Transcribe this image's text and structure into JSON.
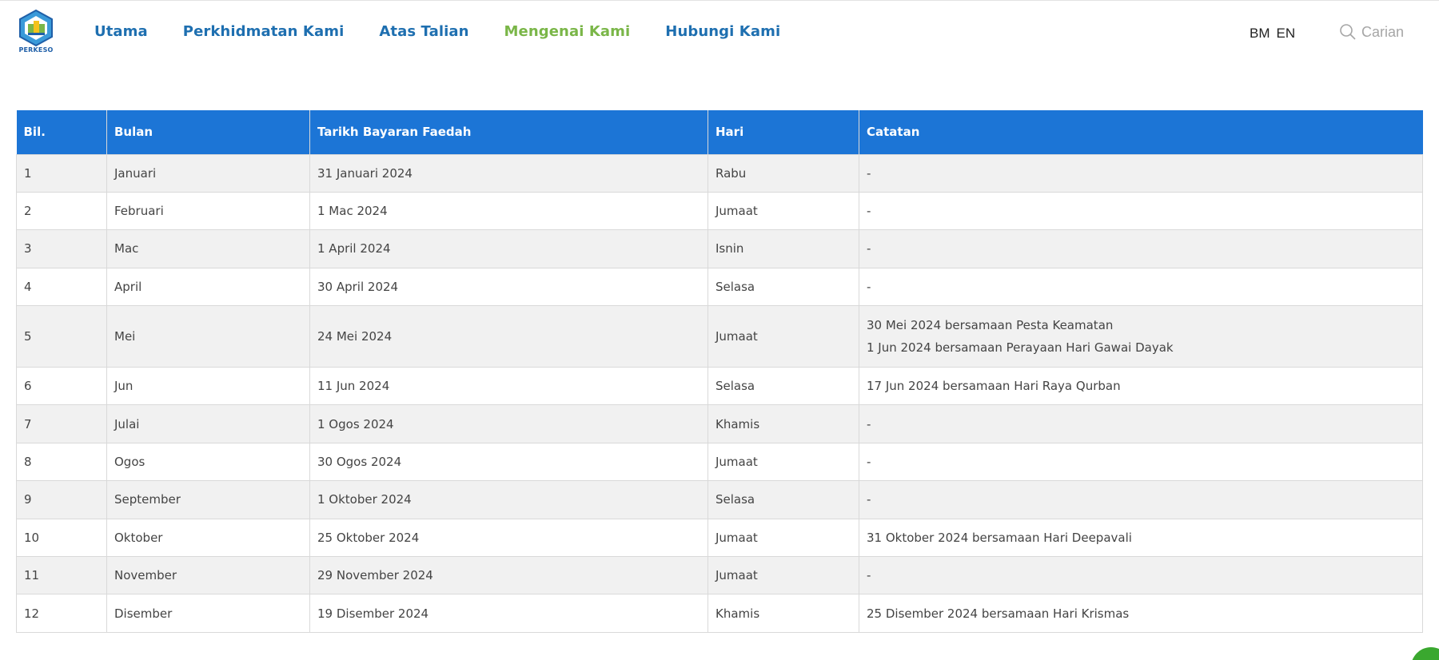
{
  "logo": {
    "text": "PERKESO"
  },
  "nav": [
    {
      "label": "Utama",
      "active": false
    },
    {
      "label": "Perkhidmatan Kami",
      "active": false
    },
    {
      "label": "Atas Talian",
      "active": false
    },
    {
      "label": "Mengenai Kami",
      "active": true
    },
    {
      "label": "Hubungi Kami",
      "active": false
    }
  ],
  "lang": {
    "bm": "BM",
    "en": "EN"
  },
  "search": {
    "placeholder": "Carian",
    "icon": "search-icon"
  },
  "colors": {
    "header_bg": "#1c75d6",
    "nav_link": "#1e6fb0",
    "nav_active": "#7ab648"
  },
  "table": {
    "headers": [
      "Bil.",
      "Bulan",
      "Tarikh Bayaran Faedah",
      "Hari",
      "Catatan"
    ],
    "rows": [
      {
        "bil": "1",
        "bulan": "Januari",
        "tarikh": "31 Januari 2024",
        "hari": "Rabu",
        "catatan": [
          "-"
        ]
      },
      {
        "bil": "2",
        "bulan": "Februari",
        "tarikh": "1 Mac 2024",
        "hari": "Jumaat",
        "catatan": [
          "-"
        ]
      },
      {
        "bil": "3",
        "bulan": "Mac",
        "tarikh": "1 April 2024",
        "hari": "Isnin",
        "catatan": [
          "-"
        ]
      },
      {
        "bil": "4",
        "bulan": "April",
        "tarikh": "30 April 2024",
        "hari": "Selasa",
        "catatan": [
          "-"
        ]
      },
      {
        "bil": "5",
        "bulan": "Mei",
        "tarikh": "24 Mei 2024",
        "hari": "Jumaat",
        "catatan": [
          "30 Mei 2024 bersamaan Pesta Keamatan",
          "1 Jun 2024 bersamaan Perayaan Hari Gawai Dayak"
        ]
      },
      {
        "bil": "6",
        "bulan": "Jun",
        "tarikh": "11 Jun 2024",
        "hari": "Selasa",
        "catatan": [
          "17 Jun 2024 bersamaan Hari Raya Qurban"
        ]
      },
      {
        "bil": "7",
        "bulan": "Julai",
        "tarikh": "1 Ogos 2024",
        "hari": "Khamis",
        "catatan": [
          "-"
        ]
      },
      {
        "bil": "8",
        "bulan": "Ogos",
        "tarikh": "30 Ogos 2024",
        "hari": "Jumaat",
        "catatan": [
          "-"
        ]
      },
      {
        "bil": "9",
        "bulan": "September",
        "tarikh": "1 Oktober 2024",
        "hari": "Selasa",
        "catatan": [
          "-"
        ]
      },
      {
        "bil": "10",
        "bulan": "Oktober",
        "tarikh": "25 Oktober 2024",
        "hari": "Jumaat",
        "catatan": [
          "31 Oktober 2024 bersamaan Hari Deepavali"
        ]
      },
      {
        "bil": "11",
        "bulan": "November",
        "tarikh": "29 November 2024",
        "hari": "Jumaat",
        "catatan": [
          "-"
        ]
      },
      {
        "bil": "12",
        "bulan": "Disember",
        "tarikh": "19 Disember 2024",
        "hari": "Khamis",
        "catatan": [
          "25 Disember 2024 bersamaan Hari Krismas"
        ]
      }
    ]
  }
}
